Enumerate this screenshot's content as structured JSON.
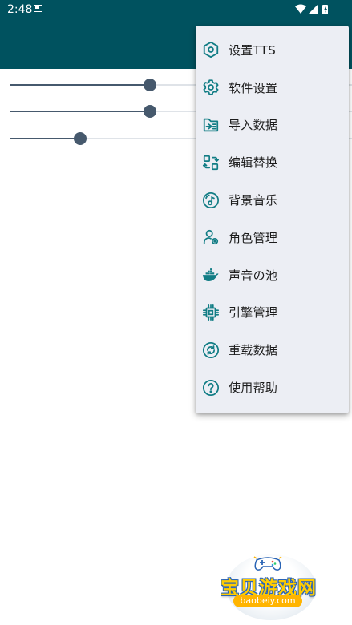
{
  "status_bar": {
    "time": "2:48"
  },
  "sliders": [
    {
      "value": 0.42
    },
    {
      "value": 0.42
    },
    {
      "value": 0.2
    }
  ],
  "menu": {
    "items": [
      {
        "label": "设置TTS",
        "icon": "hexagon-settings-icon"
      },
      {
        "label": "软件设置",
        "icon": "gear-icon"
      },
      {
        "label": "导入数据",
        "icon": "import-icon"
      },
      {
        "label": "编辑替换",
        "icon": "swap-icon"
      },
      {
        "label": "背景音乐",
        "icon": "music-disc-icon"
      },
      {
        "label": "角色管理",
        "icon": "person-settings-icon"
      },
      {
        "label": "声音の池",
        "icon": "docker-whale-icon"
      },
      {
        "label": "引擎管理",
        "icon": "chip-icon"
      },
      {
        "label": "重载数据",
        "icon": "reload-icon"
      },
      {
        "label": "使用帮助",
        "icon": "help-icon"
      }
    ]
  },
  "watermark": {
    "title": "宝贝游戏网",
    "url": "baobeiy.com"
  },
  "colors": {
    "primary": "#00525f",
    "icon": "#127d85",
    "slider": "#46596d",
    "menu_bg": "#eceef4"
  }
}
